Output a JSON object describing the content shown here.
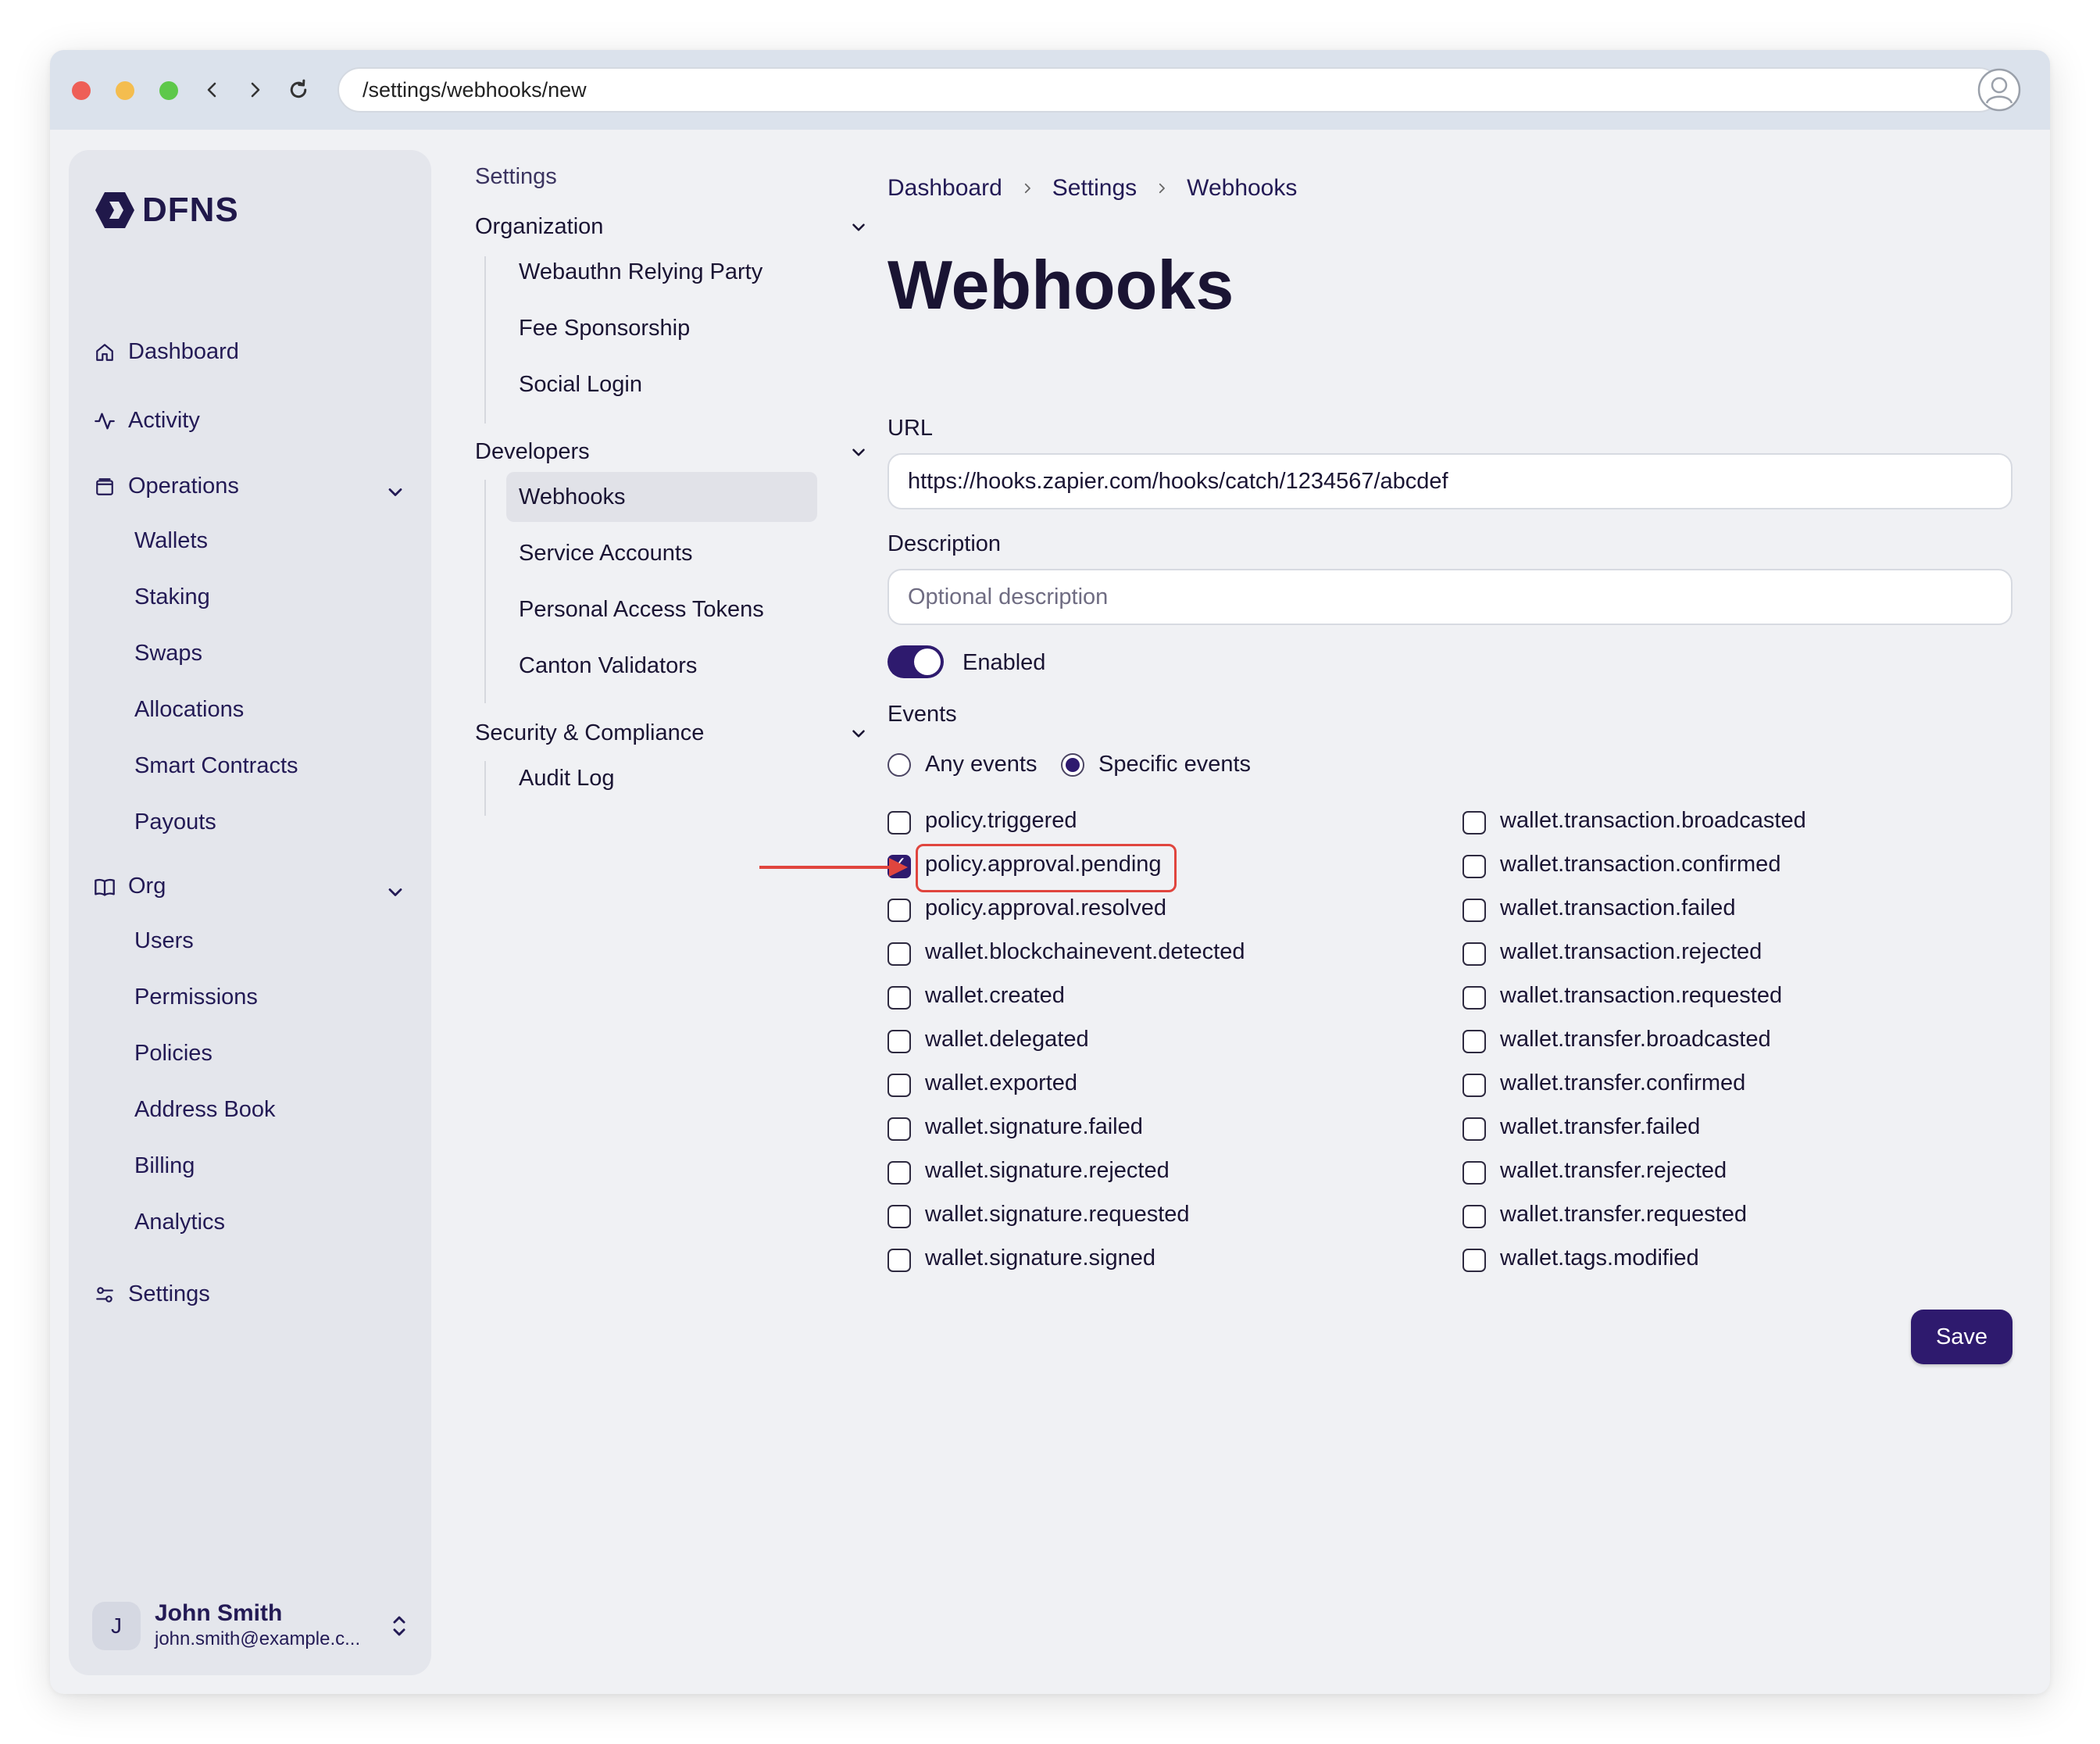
{
  "browser": {
    "url": "/settings/webhooks/new"
  },
  "sidebar": {
    "logo_text": "DFNS",
    "dashboard": "Dashboard",
    "activity": "Activity",
    "operations": {
      "label": "Operations",
      "items": [
        "Wallets",
        "Staking",
        "Swaps",
        "Allocations",
        "Smart Contracts",
        "Payouts"
      ]
    },
    "org": {
      "label": "Org",
      "items": [
        "Users",
        "Permissions",
        "Policies",
        "Address Book",
        "Billing",
        "Analytics"
      ]
    },
    "settings": "Settings",
    "user": {
      "initial": "J",
      "name": "John Smith",
      "email": "john.smith@example.c..."
    }
  },
  "settings_nav": {
    "title": "Settings",
    "groups": [
      {
        "label": "Organization",
        "items": [
          "Webauthn Relying Party",
          "Fee Sponsorship",
          "Social Login"
        ]
      },
      {
        "label": "Developers",
        "items": [
          "Webhooks",
          "Service Accounts",
          "Personal Access Tokens",
          "Canton Validators"
        ]
      },
      {
        "label": "Security & Compliance",
        "items": [
          "Audit Log"
        ]
      }
    ],
    "active": "Webhooks"
  },
  "main": {
    "breadcrumb": [
      "Dashboard",
      "Settings",
      "Webhooks"
    ],
    "title": "Webhooks",
    "url_label": "URL",
    "url_value": "https://hooks.zapier.com/hooks/catch/1234567/abcdef",
    "description_label": "Description",
    "description_placeholder": "Optional description",
    "enabled_label": "Enabled",
    "enabled": true,
    "events_label": "Events",
    "any_events_label": "Any events",
    "specific_events_label": "Specific events",
    "event_mode": "specific",
    "events_left": [
      {
        "name": "policy.triggered",
        "checked": false
      },
      {
        "name": "policy.approval.pending",
        "checked": true
      },
      {
        "name": "policy.approval.resolved",
        "checked": false
      },
      {
        "name": "wallet.blockchainevent.detected",
        "checked": false
      },
      {
        "name": "wallet.created",
        "checked": false
      },
      {
        "name": "wallet.delegated",
        "checked": false
      },
      {
        "name": "wallet.exported",
        "checked": false
      },
      {
        "name": "wallet.signature.failed",
        "checked": false
      },
      {
        "name": "wallet.signature.rejected",
        "checked": false
      },
      {
        "name": "wallet.signature.requested",
        "checked": false
      },
      {
        "name": "wallet.signature.signed",
        "checked": false
      }
    ],
    "events_right": [
      {
        "name": "wallet.transaction.broadcasted",
        "checked": false
      },
      {
        "name": "wallet.transaction.confirmed",
        "checked": false
      },
      {
        "name": "wallet.transaction.failed",
        "checked": false
      },
      {
        "name": "wallet.transaction.rejected",
        "checked": false
      },
      {
        "name": "wallet.transaction.requested",
        "checked": false
      },
      {
        "name": "wallet.transfer.broadcasted",
        "checked": false
      },
      {
        "name": "wallet.transfer.confirmed",
        "checked": false
      },
      {
        "name": "wallet.transfer.failed",
        "checked": false
      },
      {
        "name": "wallet.transfer.rejected",
        "checked": false
      },
      {
        "name": "wallet.transfer.requested",
        "checked": false
      },
      {
        "name": "wallet.tags.modified",
        "checked": false
      }
    ],
    "save_label": "Save"
  },
  "colors": {
    "accent": "#2e1a6e",
    "highlight": "#e0453e"
  }
}
